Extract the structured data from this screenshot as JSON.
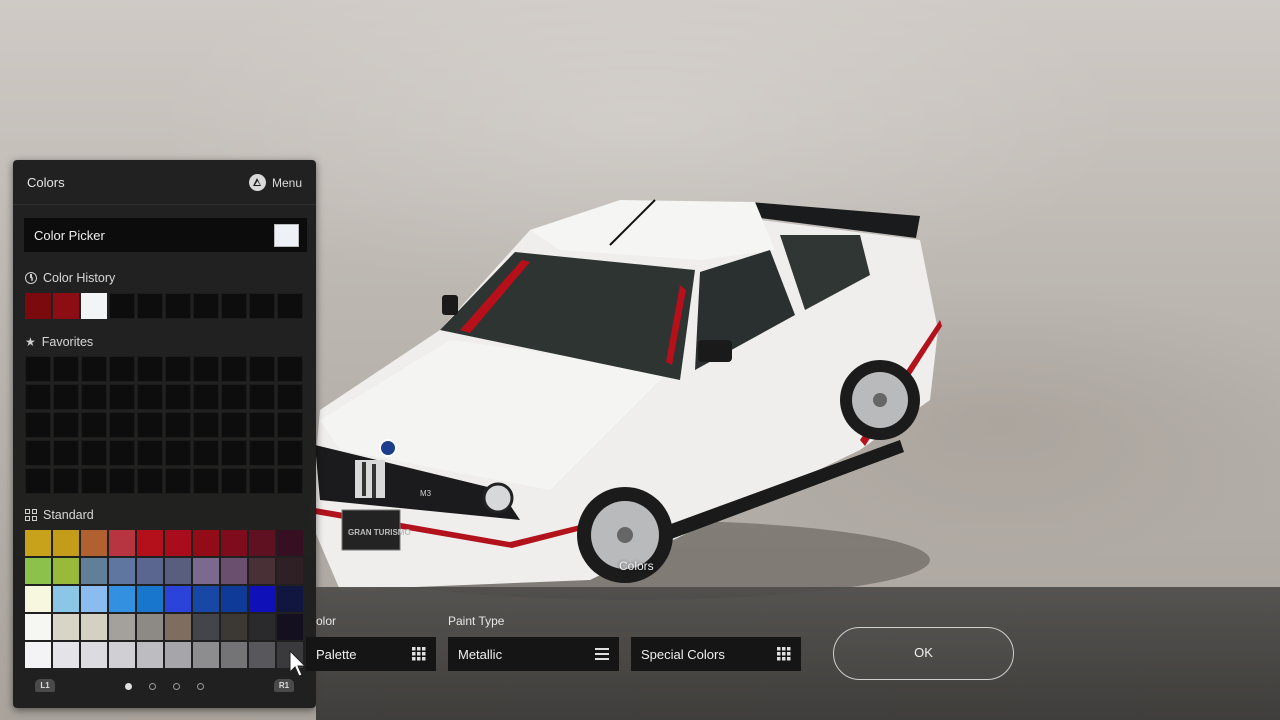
{
  "panel": {
    "title": "Colors",
    "menu_label": "Menu",
    "menu_icon": "triangle-button-icon",
    "color_picker_label": "Color Picker",
    "color_picker_swatch": "#eef2f6",
    "history_label": "Color History",
    "history": [
      "#7a0a0e",
      "#8c0d14",
      "#f2f4f6",
      "",
      "",
      "",
      "",
      "",
      "",
      ""
    ],
    "favorites_label": "Favorites",
    "standard_label": "Standard",
    "standard": [
      [
        "#c9a21b",
        "#c49c1a",
        "#b1612f",
        "#b73441",
        "#b4101c",
        "#a90d1d",
        "#920c18",
        "#7e0c1c",
        "#5f1021",
        "#361022"
      ],
      [
        "#8cc14b",
        "#98b93a",
        "#627f9a",
        "#5f77a0",
        "#5a6690",
        "#5a5e7e",
        "#7c6a8e",
        "#6b4f6e",
        "#493036",
        "#2e2024"
      ],
      [
        "#f7f6df",
        "#8cc6e6",
        "#8bbcf0",
        "#3390e0",
        "#1976cd",
        "#2b43d8",
        "#1748a6",
        "#0f3a97",
        "#1010b8",
        "#101640"
      ],
      [
        "#f6f6f2",
        "#d9d5c6",
        "#d4d0c2",
        "#a4a19d",
        "#8d8a86",
        "#7f6e5f",
        "#44454a",
        "#3c3833",
        "#2a2a2c",
        "#14101f"
      ],
      [
        "#f3f3f6",
        "#e3e3e8",
        "#dcdce0",
        "#d0d0d4",
        "#bdbdc1",
        "#a6a6aa",
        "#8d8d90",
        "#747477",
        "#58585c",
        "#3a3a3d"
      ]
    ],
    "pager": {
      "left": "L1",
      "right": "R1",
      "pages": 4,
      "active": 0
    }
  },
  "bottom": {
    "title": "Colors",
    "field1_label_partial": "olor",
    "field1_value": "Palette",
    "paint_type_label": "Paint Type",
    "paint_type_value": "Metallic",
    "special_value": "Special Colors",
    "ok_label": "OK"
  },
  "car": {
    "badge_text": "GRAN TURISMO",
    "grille_badge": "M3"
  }
}
